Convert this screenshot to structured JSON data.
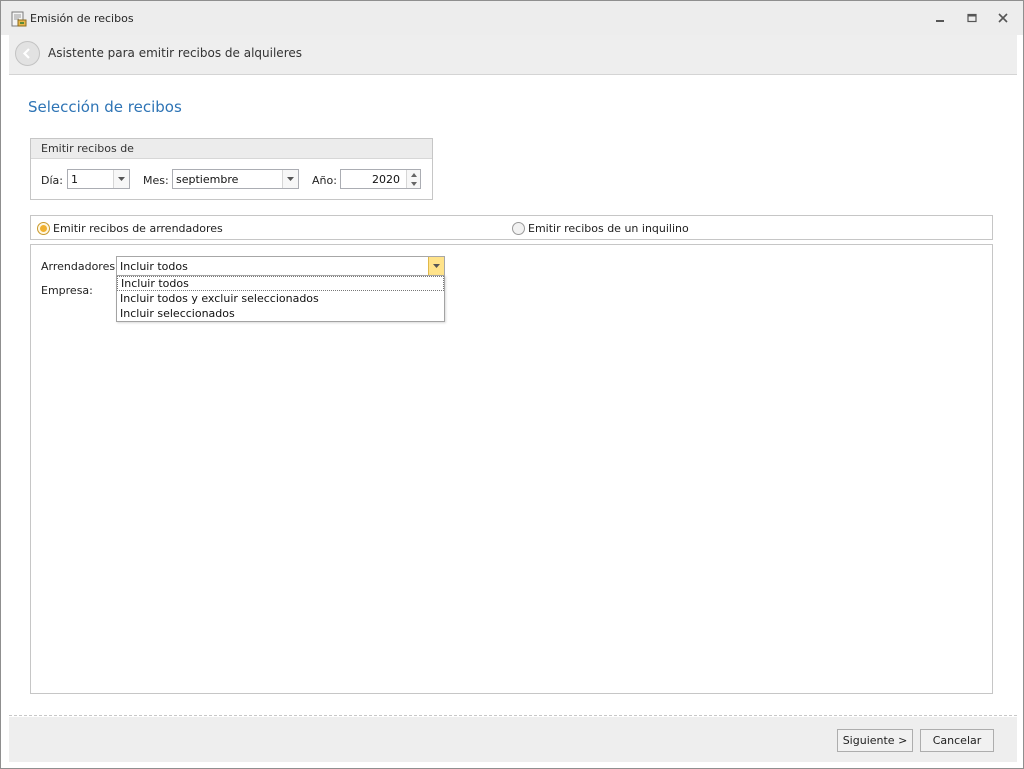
{
  "window": {
    "title": "Emisión de recibos",
    "icon": "receipt-app-icon"
  },
  "wizard": {
    "header_title": "Asistente para emitir recibos de alquileres",
    "page_title": "Selección de recibos"
  },
  "emit_group": {
    "title": "Emitir recibos de",
    "day_label": "Día:",
    "day_value": "1",
    "month_label": "Mes:",
    "month_value": "septiembre",
    "year_label": "Año:",
    "year_value": "2020"
  },
  "radio_options": {
    "landlords": {
      "label": "Emitir recibos de arrendadores",
      "checked": true
    },
    "tenant": {
      "label": "Emitir recibos de un inquilino",
      "checked": false
    }
  },
  "filters": {
    "arrendadores_label": "Arrendadores:",
    "arrendadores_value": "Incluir todos",
    "empresa_label": "Empresa:",
    "dropdown_options": [
      "Incluir todos",
      "Incluir todos y excluir seleccionados",
      "Incluir seleccionados"
    ]
  },
  "footer": {
    "next_label": "Siguiente >",
    "cancel_label": "Cancelar"
  },
  "colors": {
    "accent": "#2e74b5",
    "radio_selected": "#f0b030",
    "active_dropdown": "#ffe38a"
  }
}
